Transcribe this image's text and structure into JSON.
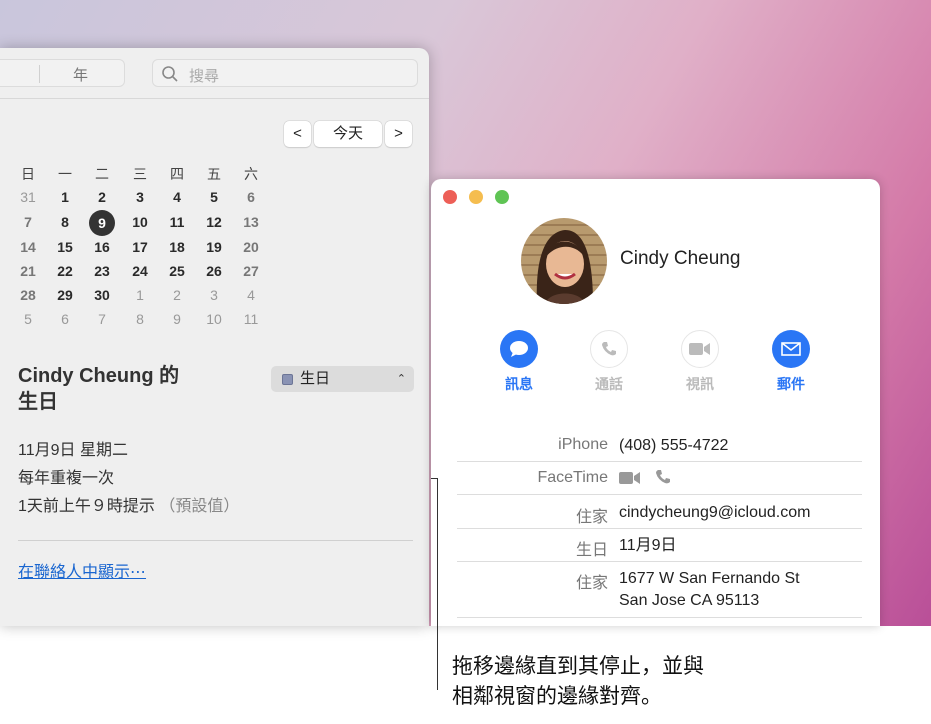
{
  "calendar_window": {
    "toolbar": {
      "view_year": "年",
      "search_placeholder": "搜尋"
    },
    "nav": {
      "prev": "<",
      "today": "今天",
      "next": ">"
    },
    "weekdays": [
      "日",
      "一",
      "二",
      "三",
      "四",
      "五",
      "六"
    ],
    "weeks": [
      [
        "31",
        "1",
        "2",
        "3",
        "4",
        "5",
        "6"
      ],
      [
        "7",
        "8",
        "9",
        "10",
        "11",
        "12",
        "13"
      ],
      [
        "14",
        "15",
        "16",
        "17",
        "18",
        "19",
        "20"
      ],
      [
        "21",
        "22",
        "23",
        "24",
        "25",
        "26",
        "27"
      ],
      [
        "28",
        "29",
        "30",
        "1",
        "2",
        "3",
        "4"
      ],
      [
        "5",
        "6",
        "7",
        "8",
        "9",
        "10",
        "11"
      ]
    ],
    "selected_day": "9",
    "event": {
      "title_line1": "Cindy Cheung 的",
      "title_line2": "生日",
      "calendar": "生日",
      "calendar_color": "#8a93b4",
      "date": "11月9日 星期二",
      "repeat": "每年重複一次",
      "alert": "1天前上午９時提示",
      "alert_note": "（預設值）",
      "link": "在聯絡人中顯示⋯"
    }
  },
  "contact_window": {
    "name": "Cindy Cheung",
    "actions": [
      {
        "label": "訊息",
        "icon": "message-icon",
        "enabled": true
      },
      {
        "label": "通話",
        "icon": "phone-icon",
        "enabled": false
      },
      {
        "label": "視訊",
        "icon": "video-icon",
        "enabled": false
      },
      {
        "label": "郵件",
        "icon": "mail-icon",
        "enabled": true
      }
    ],
    "fields": [
      {
        "label": "iPhone",
        "value": "(408) 555-4722"
      },
      {
        "label": "FaceTime",
        "value": ""
      },
      {
        "label": "住家",
        "value": "cindycheung9@icloud.com"
      },
      {
        "label": "生日",
        "value": "11月9日"
      },
      {
        "label": "住家",
        "value": "1677 W San Fernando St",
        "value2": "San Jose CA 95113"
      }
    ],
    "accent": "#2a76f5"
  },
  "caption": {
    "line1": "拖移邊緣直到其停止，並與",
    "line2": "相鄰視窗的邊緣對齊。"
  }
}
